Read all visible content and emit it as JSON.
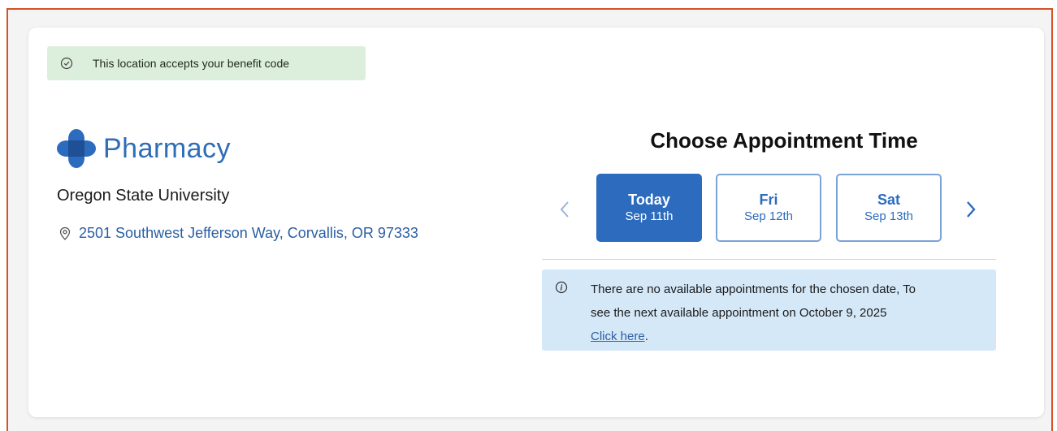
{
  "banner": {
    "text": "This location accepts your benefit code",
    "icon": "check-circle-icon"
  },
  "location": {
    "brand": "Pharmacy",
    "logo": "pharmacy-cross-logo",
    "name": "Oregon State University",
    "address": "2501 Southwest Jefferson Way, Corvallis, OR 97333",
    "address_icon": "map-pin-icon"
  },
  "appointment": {
    "title": "Choose Appointment Time",
    "prev_icon": "chevron-left-icon",
    "next_icon": "chevron-right-icon",
    "dates": [
      {
        "day": "Today",
        "date": "Sep 11th",
        "selected": true
      },
      {
        "day": "Fri",
        "date": "Sep 12th",
        "selected": false
      },
      {
        "day": "Sat",
        "date": "Sep 13th",
        "selected": false
      }
    ],
    "notice": {
      "icon": "info-icon",
      "line1": "There are no available appointments for the chosen date, To",
      "line2": "see the next available appointment on October 9, 2025",
      "link_text": "Click here",
      "suffix": "."
    }
  },
  "colors": {
    "accent": "#2c6bbd",
    "banner_bg": "#dcefdc",
    "notice_bg": "#d5e8f8",
    "frame_border": "#d5512a"
  }
}
